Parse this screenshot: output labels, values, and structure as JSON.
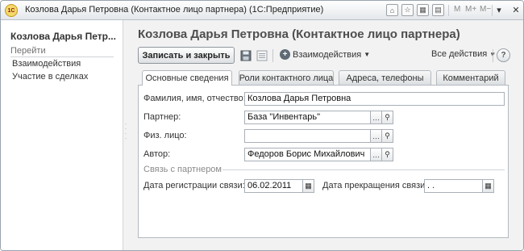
{
  "window": {
    "app_logo": "1С",
    "title": "Козлова Дарья Петровна (Контактное лицо партнера)  (1С:Предприятие)",
    "toolbar_icons": [
      "home-icon",
      "favorites-icon",
      "calendar-icon",
      "calculator-icon"
    ],
    "memory_labels": [
      "M",
      "M+",
      "M−"
    ],
    "controls": [
      "menu-icon",
      "minimize-icon",
      "maximize-icon",
      "close-icon"
    ]
  },
  "sidebar": {
    "title": "Козлова Дарья Петр...",
    "section": "Перейти",
    "items": [
      {
        "label": "Взаимодействия"
      },
      {
        "label": "Участие в сделках"
      }
    ]
  },
  "header": {
    "title": "Козлова Дарья Петровна (Контактное лицо партнера)"
  },
  "toolbar": {
    "save_close_label": "Записать и закрыть",
    "interactions_label": "Взаимодействия",
    "all_actions_label": "Все действия",
    "help_label": "?"
  },
  "tabs": [
    {
      "label": "Основные сведения",
      "active": true
    },
    {
      "label": "Роли контактного лица",
      "active": false
    },
    {
      "label": "Адреса, телефоны",
      "active": false
    },
    {
      "label": "Комментарий",
      "active": false
    }
  ],
  "form": {
    "full_name": {
      "label": "Фамилия, имя, отчество:",
      "value": "Козлова Дарья Петровна"
    },
    "partner": {
      "label": "Партнер:",
      "value": "База \"Инвентарь\""
    },
    "individual": {
      "label": "Физ. лицо:",
      "value": ""
    },
    "author": {
      "label": "Автор:",
      "value": "Федоров Борис Михайлович"
    },
    "link_section": "Связь с партнером",
    "reg_date": {
      "label": "Дата регистрации связи:",
      "value": "06.02.2011"
    },
    "end_date": {
      "label": "Дата прекращения связи:",
      "value": " .  ."
    }
  },
  "colors": {
    "title_text": "#4e4e4e",
    "window_bg": "#f2f2f2",
    "border": "#9aa4ae"
  }
}
